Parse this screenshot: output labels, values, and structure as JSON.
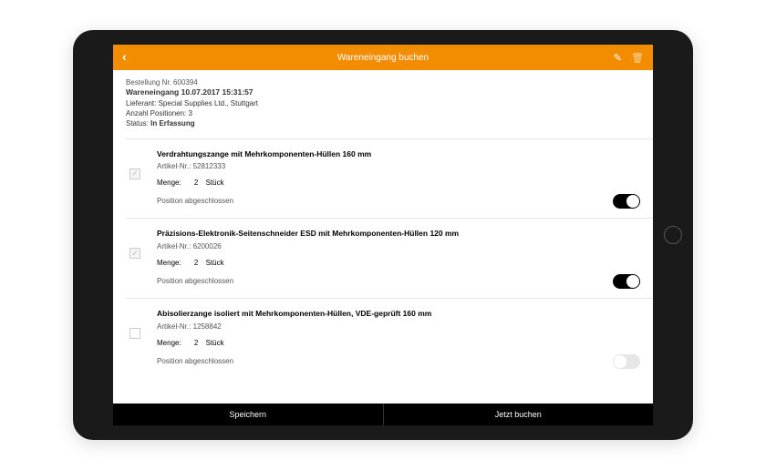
{
  "header": {
    "title": "Wareneingang buchen"
  },
  "meta": {
    "order_label": "Bestellung Nr.",
    "order_nr": "600394",
    "title": "Wareneingang 10.07.2017 15:31:57",
    "supplier_label": "Lieferant:",
    "supplier": "Special Supplies Ltd., Stuttgart",
    "positions_label": "Anzahl Positionen:",
    "positions": "3",
    "status_label": "Status:",
    "status": "In Erfassung"
  },
  "labels": {
    "article": "Artikel-Nr.:",
    "qty": "Menge:",
    "unit": "Stück",
    "pos_closed": "Position abgeschlossen"
  },
  "items": [
    {
      "name": "Verdrahtungszange mit Mehrkomponenten-Hüllen 160 mm",
      "article": "52812333",
      "qty": "2",
      "checked": true,
      "closed": true
    },
    {
      "name": "Präzisions-Elektronik-Seitenschneider ESD mit Mehrkomponenten-Hüllen 120 mm",
      "article": "6200026",
      "qty": "2",
      "checked": true,
      "closed": true
    },
    {
      "name": "Abisolierzange isoliert mit Mehrkomponenten-Hüllen, VDE-geprüft 160 mm",
      "article": "1258842",
      "qty": "2",
      "checked": false,
      "closed": false
    }
  ],
  "footer": {
    "save": "Speichern",
    "book": "Jetzt buchen"
  },
  "colors": {
    "accent": "#f28c00"
  }
}
